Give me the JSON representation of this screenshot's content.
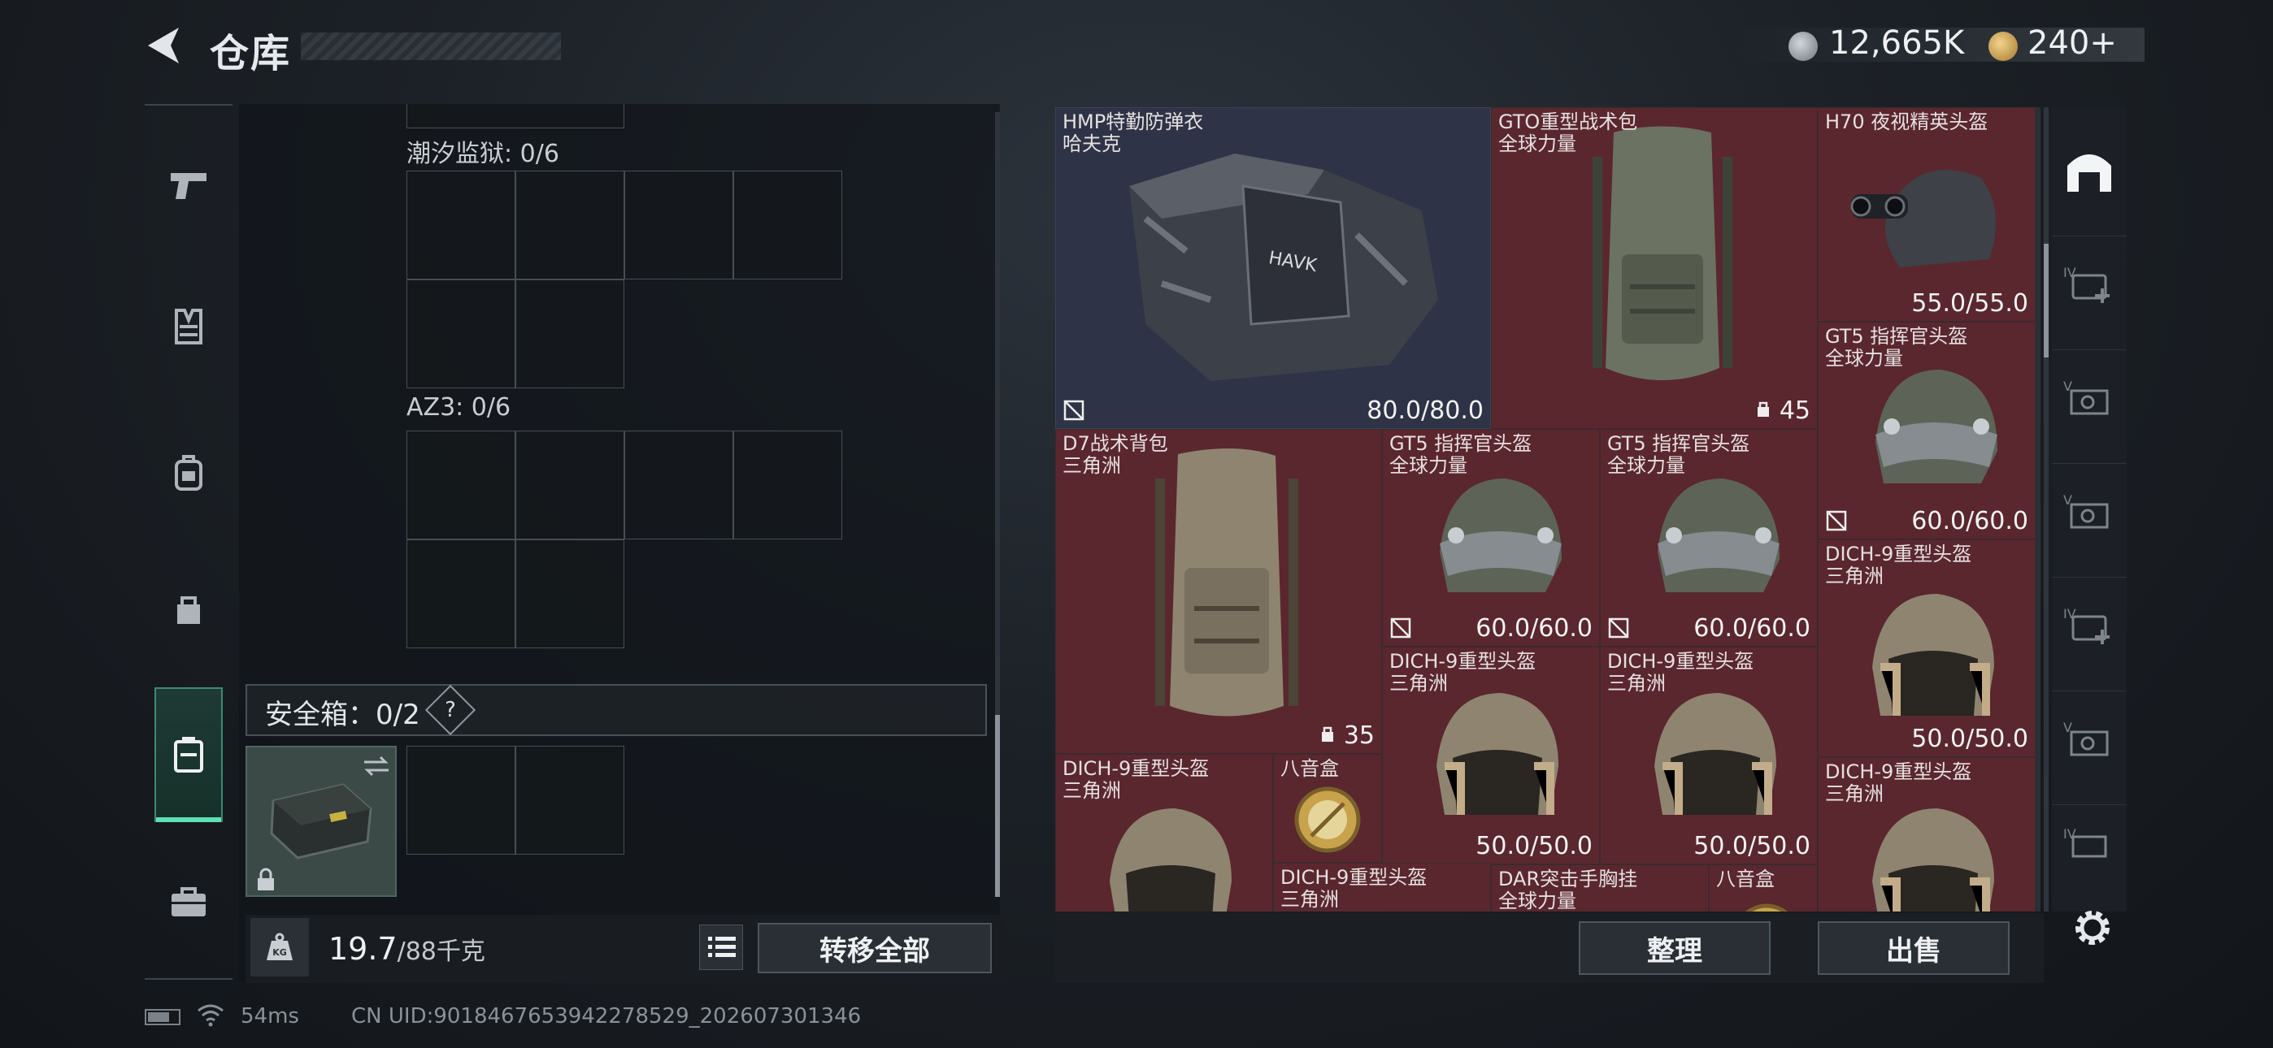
{
  "header": {
    "title": "仓库",
    "currency_primary": "12,665K",
    "currency_secondary": "240+"
  },
  "nav": {
    "items": [
      {
        "icon": "pistol-icon"
      },
      {
        "icon": "vest-icon"
      },
      {
        "icon": "backpack-icon"
      },
      {
        "icon": "bag-icon"
      },
      {
        "icon": "safe-case-icon",
        "active": true
      },
      {
        "icon": "toolbox-icon"
      }
    ]
  },
  "containers": {
    "tide_prison_label": "潮汐监狱: 0/6",
    "az3_label": "AZ3: 0/6",
    "safe_box_label": "安全箱：0/2",
    "safe_help": "?"
  },
  "footer_left": {
    "weight_current": "19.7",
    "weight_max": "/88千克",
    "transfer_all": "转移全部"
  },
  "status": {
    "ping": "54ms",
    "uid": "CN UID:9018467653942278529_202607301346"
  },
  "items": [
    {
      "name": "HMP特勤防弹衣",
      "sub": "哈夫克",
      "value": "80.0/80.0"
    },
    {
      "name": "GTO重型战术包",
      "sub": "全球力量",
      "value": "45"
    },
    {
      "name": "H70 夜视精英头盔",
      "sub": "",
      "value": "55.0/55.0"
    },
    {
      "name": "GT5 指挥官头盔",
      "sub": "全球力量",
      "value": "60.0/60.0"
    },
    {
      "name": "D7战术背包",
      "sub": "三角洲",
      "value": "35"
    },
    {
      "name": "GT5 指挥官头盔",
      "sub": "全球力量",
      "value": "60.0/60.0"
    },
    {
      "name": "GT5 指挥官头盔",
      "sub": "全球力量",
      "value": "60.0/60.0"
    },
    {
      "name": "DICH-9重型头盔",
      "sub": "三角洲",
      "value": "50.0/50.0"
    },
    {
      "name": "DICH-9重型头盔",
      "sub": "三角洲",
      "value": "50.0/50.0"
    },
    {
      "name": "DICH-9重型头盔",
      "sub": "三角洲",
      "value": "50.0/50.0"
    },
    {
      "name": "DICH-9重型头盔",
      "sub": "三角洲",
      "value": ""
    },
    {
      "name": "八音盒",
      "sub": "",
      "value": ""
    },
    {
      "name": "DICH-9重型头盔",
      "sub": "三角洲",
      "value": ""
    },
    {
      "name": "DICH-9重型头盔",
      "sub": "三角洲",
      "value": ""
    },
    {
      "name": "DAR突击手胸挂",
      "sub": "全球力量",
      "value": ""
    },
    {
      "name": "八音盒",
      "sub": "",
      "value": ""
    }
  ],
  "footer_right": {
    "sort": "整理",
    "sell": "出售"
  },
  "colors": {
    "accent": "#5fe0b5",
    "item_red_bg": "#5a272e",
    "item_blue_bg": "#2e3347"
  }
}
